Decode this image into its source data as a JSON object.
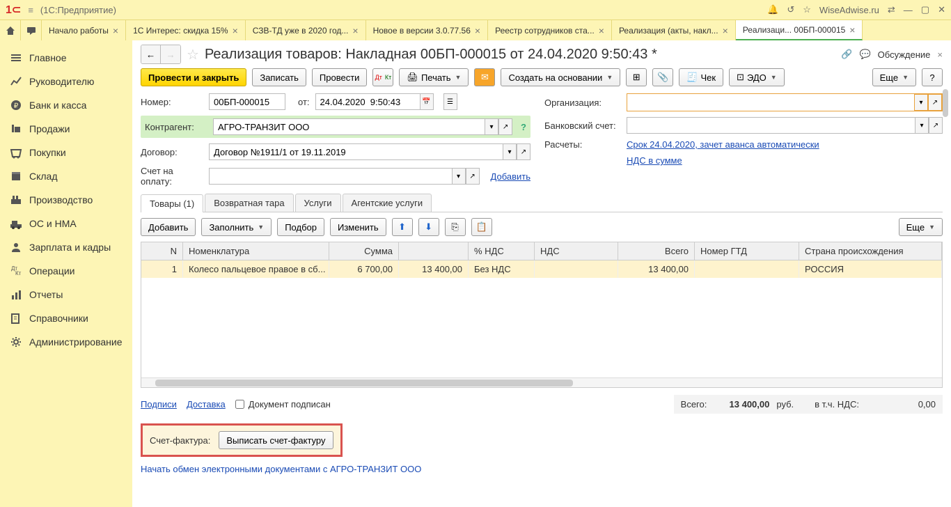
{
  "titlebar": {
    "app": "(1C:Предприятие)",
    "site": "WiseAdwise.ru"
  },
  "tabs": [
    {
      "label": "Начало работы"
    },
    {
      "label": "1С Интерес: скидка 15%"
    },
    {
      "label": "СЗВ-ТД уже в 2020 год..."
    },
    {
      "label": "Новое в версии 3.0.77.56"
    },
    {
      "label": "Реестр сотрудников ста..."
    },
    {
      "label": "Реализация (акты, накл..."
    },
    {
      "label": "Реализаци... 00БП-000015"
    }
  ],
  "sidebar": [
    {
      "label": "Главное"
    },
    {
      "label": "Руководителю"
    },
    {
      "label": "Банк и касса"
    },
    {
      "label": "Продажи"
    },
    {
      "label": "Покупки"
    },
    {
      "label": "Склад"
    },
    {
      "label": "Производство"
    },
    {
      "label": "ОС и НМА"
    },
    {
      "label": "Зарплата и кадры"
    },
    {
      "label": "Операции"
    },
    {
      "label": "Отчеты"
    },
    {
      "label": "Справочники"
    },
    {
      "label": "Администрирование"
    }
  ],
  "page": {
    "title": "Реализация товаров: Накладная 00БП-000015 от 24.04.2020 9:50:43 *",
    "discuss": "Обсуждение"
  },
  "toolbar": {
    "postclose": "Провести и закрыть",
    "save": "Записать",
    "post": "Провести",
    "print": "Печать",
    "createbase": "Создать на основании",
    "check": "Чек",
    "edo": "ЭДО",
    "more": "Еще"
  },
  "form": {
    "number_lbl": "Номер:",
    "number": "00БП-000015",
    "from_lbl": "от:",
    "date": "24.04.2020  9:50:43",
    "contragent_lbl": "Контрагент:",
    "contragent": "АГРО-ТРАНЗИТ ООО",
    "contract_lbl": "Договор:",
    "contract": "Договор №1911/1 от 19.11.2019",
    "invoice_lbl": "Счет на оплату:",
    "invoice": "",
    "add_link": "Добавить",
    "org_lbl": "Организация:",
    "org": "",
    "bank_lbl": "Банковский счет:",
    "bank": "",
    "calc_lbl": "Расчеты:",
    "calc_link": "Срок 24.04.2020, зачет аванса автоматически",
    "nds_link": "НДС в сумме"
  },
  "inntabs": {
    "goods": "Товары (1)",
    "tara": "Возвратная тара",
    "services": "Услуги",
    "agent": "Агентские услуги"
  },
  "tbltoolbar": {
    "add": "Добавить",
    "fill": "Заполнить",
    "select": "Подбор",
    "edit": "Изменить",
    "more": "Еще"
  },
  "table": {
    "headers": {
      "n": "N",
      "nom": "Номенклатура",
      "sum": "Сумма",
      "ndsp": "% НДС",
      "nds": "НДС",
      "total": "Всего",
      "gtd": "Номер ГТД",
      "country": "Страна происхождения"
    },
    "rows": [
      {
        "n": "1",
        "nom": "Колесо пальцевое правое в сб...",
        "price": "6 700,00",
        "sum": "13 400,00",
        "ndsp": "Без НДС",
        "nds": "",
        "total": "13 400,00",
        "gtd": "",
        "country": "РОССИЯ"
      }
    ]
  },
  "footer": {
    "sign": "Подписи",
    "delivery": "Доставка",
    "signed": "Документ подписан",
    "total_lbl": "Всего:",
    "total": "13 400,00",
    "rub": "руб.",
    "vat_lbl": "в т.ч. НДС:",
    "vat": "0,00",
    "sf_lbl": "Счет-фактура:",
    "sf_btn": "Выписать счет-фактуру",
    "exchange": "Начать обмен электронными документами с АГРО-ТРАНЗИТ ООО"
  }
}
